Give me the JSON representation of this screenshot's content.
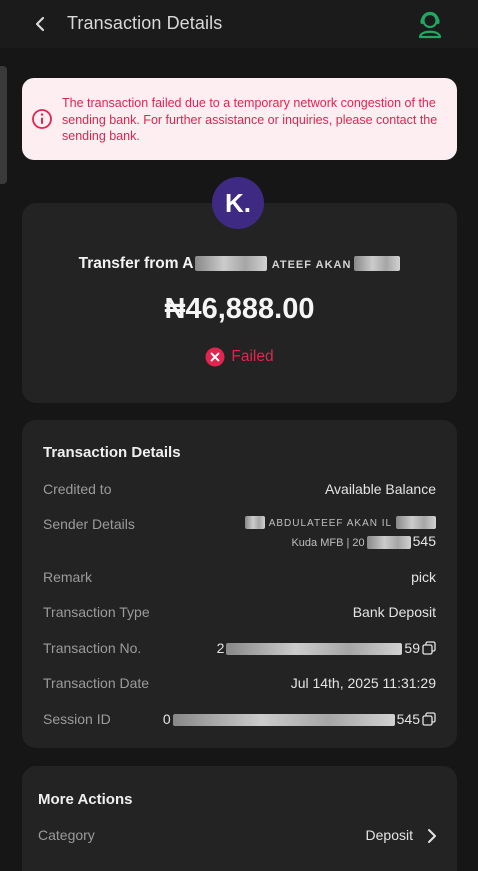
{
  "header": {
    "title": "Transaction Details",
    "accent_color": "#1fa963"
  },
  "alert": {
    "text": "The transaction failed due to a temporary network congestion of the sending bank. For further assistance or inquiries, please contact the sending bank.",
    "color": "#e2244f",
    "background": "#fdeef2"
  },
  "merchant": {
    "logo_text": "K.",
    "logo_color": "#3e2a83"
  },
  "summary": {
    "transfer_prefix": "Transfer from A",
    "transfer_visible_fragment": "ATEEF AKAN",
    "amount": "₦46,888.00",
    "status": "Failed",
    "status_color": "#e2244f"
  },
  "details": {
    "title": "Transaction Details",
    "credited_to": {
      "label": "Credited to",
      "value": "Available Balance"
    },
    "sender": {
      "label": "Sender Details",
      "line1_fragment": "ABDULATEEF AKAN IL",
      "line2_prefix": "Kuda MFB | 20",
      "line2_suffix": "545"
    },
    "remark": {
      "label": "Remark",
      "value": "pick"
    },
    "type": {
      "label": "Transaction Type",
      "value": "Bank Deposit"
    },
    "number": {
      "label": "Transaction No.",
      "prefix": "2",
      "suffix": "59"
    },
    "date": {
      "label": "Transaction Date",
      "value": "Jul 14th, 2025 11:31:29"
    },
    "session": {
      "label": "Session ID",
      "prefix": "0",
      "suffix": "545"
    }
  },
  "more_actions": {
    "title": "More Actions",
    "category_label": "Category",
    "category_value": "Deposit"
  }
}
